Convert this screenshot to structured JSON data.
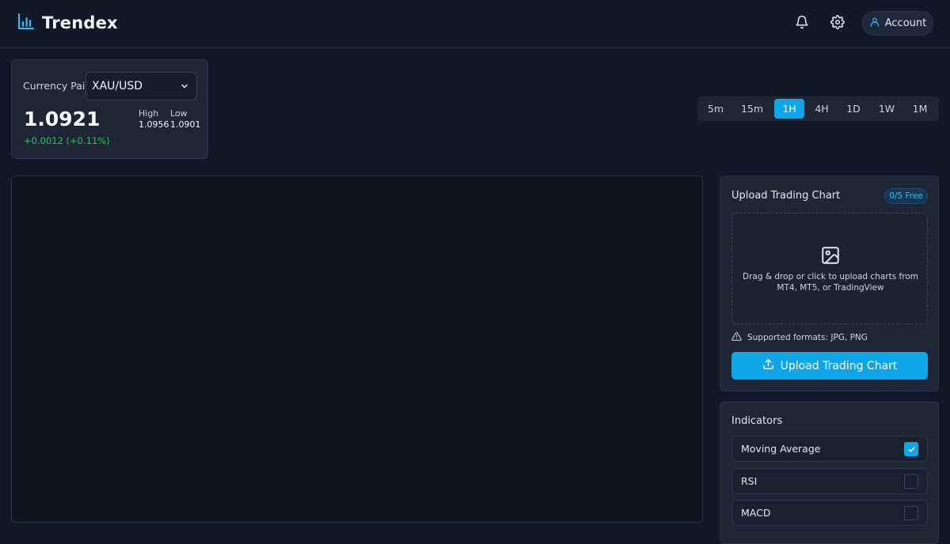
{
  "app": {
    "name": "Trendex"
  },
  "header": {
    "account_label": "Account"
  },
  "pair": {
    "label": "Currency Pair",
    "selected": "XAU/USD",
    "price": "1.0921",
    "change": "+0.0012 (+0.11%)",
    "high_label": "High",
    "high_value": "1.0956",
    "low_label": "Low",
    "low_value": "1.0901"
  },
  "timeframes": {
    "items": [
      "5m",
      "15m",
      "1H",
      "4H",
      "1D",
      "1W",
      "1M"
    ],
    "active": "1H"
  },
  "upload": {
    "title": "Upload Trading Chart",
    "badge": "0/5 Free",
    "dropzone_text": "Drag & drop or click to upload charts from MT4, MT5, or TradingView",
    "formats": "Supported formats: JPG, PNG",
    "button_label": "Upload Trading Chart"
  },
  "indicators": {
    "title": "Indicators",
    "items": [
      {
        "label": "Moving Average",
        "checked": true
      },
      {
        "label": "RSI",
        "checked": false
      },
      {
        "label": "MACD",
        "checked": false
      }
    ]
  },
  "colors": {
    "accent": "#0ea5e9",
    "positive": "#22c55e",
    "background": "#111827",
    "card": "#1e2636"
  }
}
